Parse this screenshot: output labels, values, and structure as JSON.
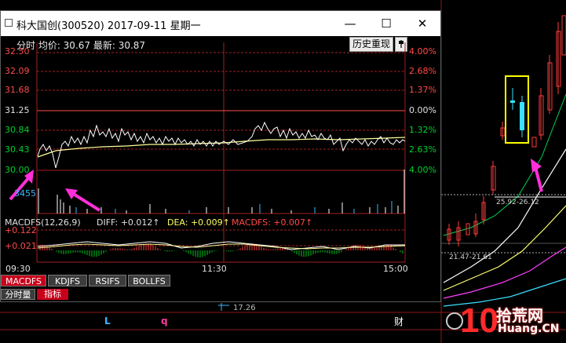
{
  "window": {
    "title": "科大国创(300520) 2017-09-11 星期一",
    "btn_min": "—",
    "btn_max": "☐",
    "btn_close": "✕"
  },
  "header": {
    "text": "分时 均价: 30.67 最新: 30.87",
    "history_label": "历史重现",
    "pin_icon": "pin-icon"
  },
  "price_axis_left": [
    "32.50",
    "32.09",
    "31.68",
    "31.25",
    "30.84",
    "30.43",
    "30.00"
  ],
  "price_axis_right": [
    "4.00%",
    "2.68%",
    "1.37%",
    "0.00%",
    "1.32%",
    "2.63%",
    "4.00%"
  ],
  "volume_label": "3455",
  "macd": {
    "label": "MACDFS(12,26,9)",
    "diff": "DIFF: +0.012↑",
    "dea": "DEA: +0.009↑",
    "macdfs": "MACDFS: +0.007↑",
    "axis_top": "+0.122",
    "axis_mid": "+0.021"
  },
  "time_axis": [
    "09:30",
    "11:30",
    "15:00"
  ],
  "tabs": [
    "MACDFS",
    "KDJFS",
    "RSIFS",
    "BOLLFS"
  ],
  "subtabs": [
    "分时量",
    "指标"
  ],
  "background": {
    "label_l": "L",
    "label_q": "q",
    "label_cai": "财",
    "price_label": "17.26",
    "range_label_a": "25.92-26.12",
    "range_label_b": "21.47-21.61"
  },
  "watermark": {
    "num": "10",
    "text": "拾荒网",
    "url": "Huang.CN"
  },
  "colors": {
    "up": "#ff3b3b",
    "down": "#00c81e",
    "price_line": "#ffffff",
    "avg_line": "#ffff9a",
    "accent_pink": "#ff2fd9",
    "tab_active": "#c8001a"
  }
}
